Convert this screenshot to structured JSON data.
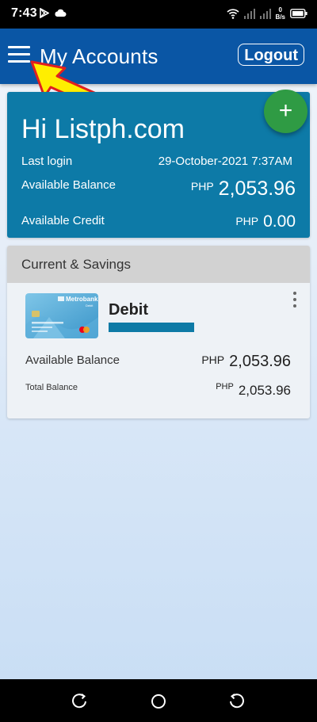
{
  "status_bar": {
    "time": "7:43",
    "net_speed_value": "0",
    "net_speed_unit": "B/s"
  },
  "app_bar": {
    "title": "My Accounts",
    "logout_label": "Logout"
  },
  "summary": {
    "greeting": "Hi Listph.com",
    "last_login_label": "Last login",
    "last_login_value": "29-October-2021 7:37AM",
    "available_balance_label": "Available Balance",
    "available_balance_currency": "PHP",
    "available_balance_amount": "2,053.96",
    "available_credit_label": "Available Credit",
    "available_credit_currency": "PHP",
    "available_credit_amount": "0.00",
    "fab_symbol": "+"
  },
  "accounts_section": {
    "title": "Current & Savings",
    "card": {
      "bank_brand": "Metrobank",
      "brand_subtitle": "Debit",
      "name": "Debit",
      "available_balance_label": "Available Balance",
      "available_balance_currency": "PHP",
      "available_balance_amount": "2,053.96",
      "total_balance_label": "Total Balance",
      "total_balance_currency": "PHP",
      "total_balance_amount": "2,053.96"
    }
  },
  "colors": {
    "app_bar": "#0a56a5",
    "summary_card": "#0d7aa7",
    "fab": "#2f9b44",
    "annotation_arrow_fill": "#ffee00",
    "annotation_arrow_stroke": "#e02020"
  },
  "icons": {
    "status_left": [
      "play-store-icon",
      "cloud-icon"
    ],
    "status_right": [
      "wifi-icon",
      "signal-icon",
      "signal-icon",
      "battery-icon"
    ],
    "nav": [
      "recents-icon",
      "home-icon",
      "back-icon"
    ]
  }
}
